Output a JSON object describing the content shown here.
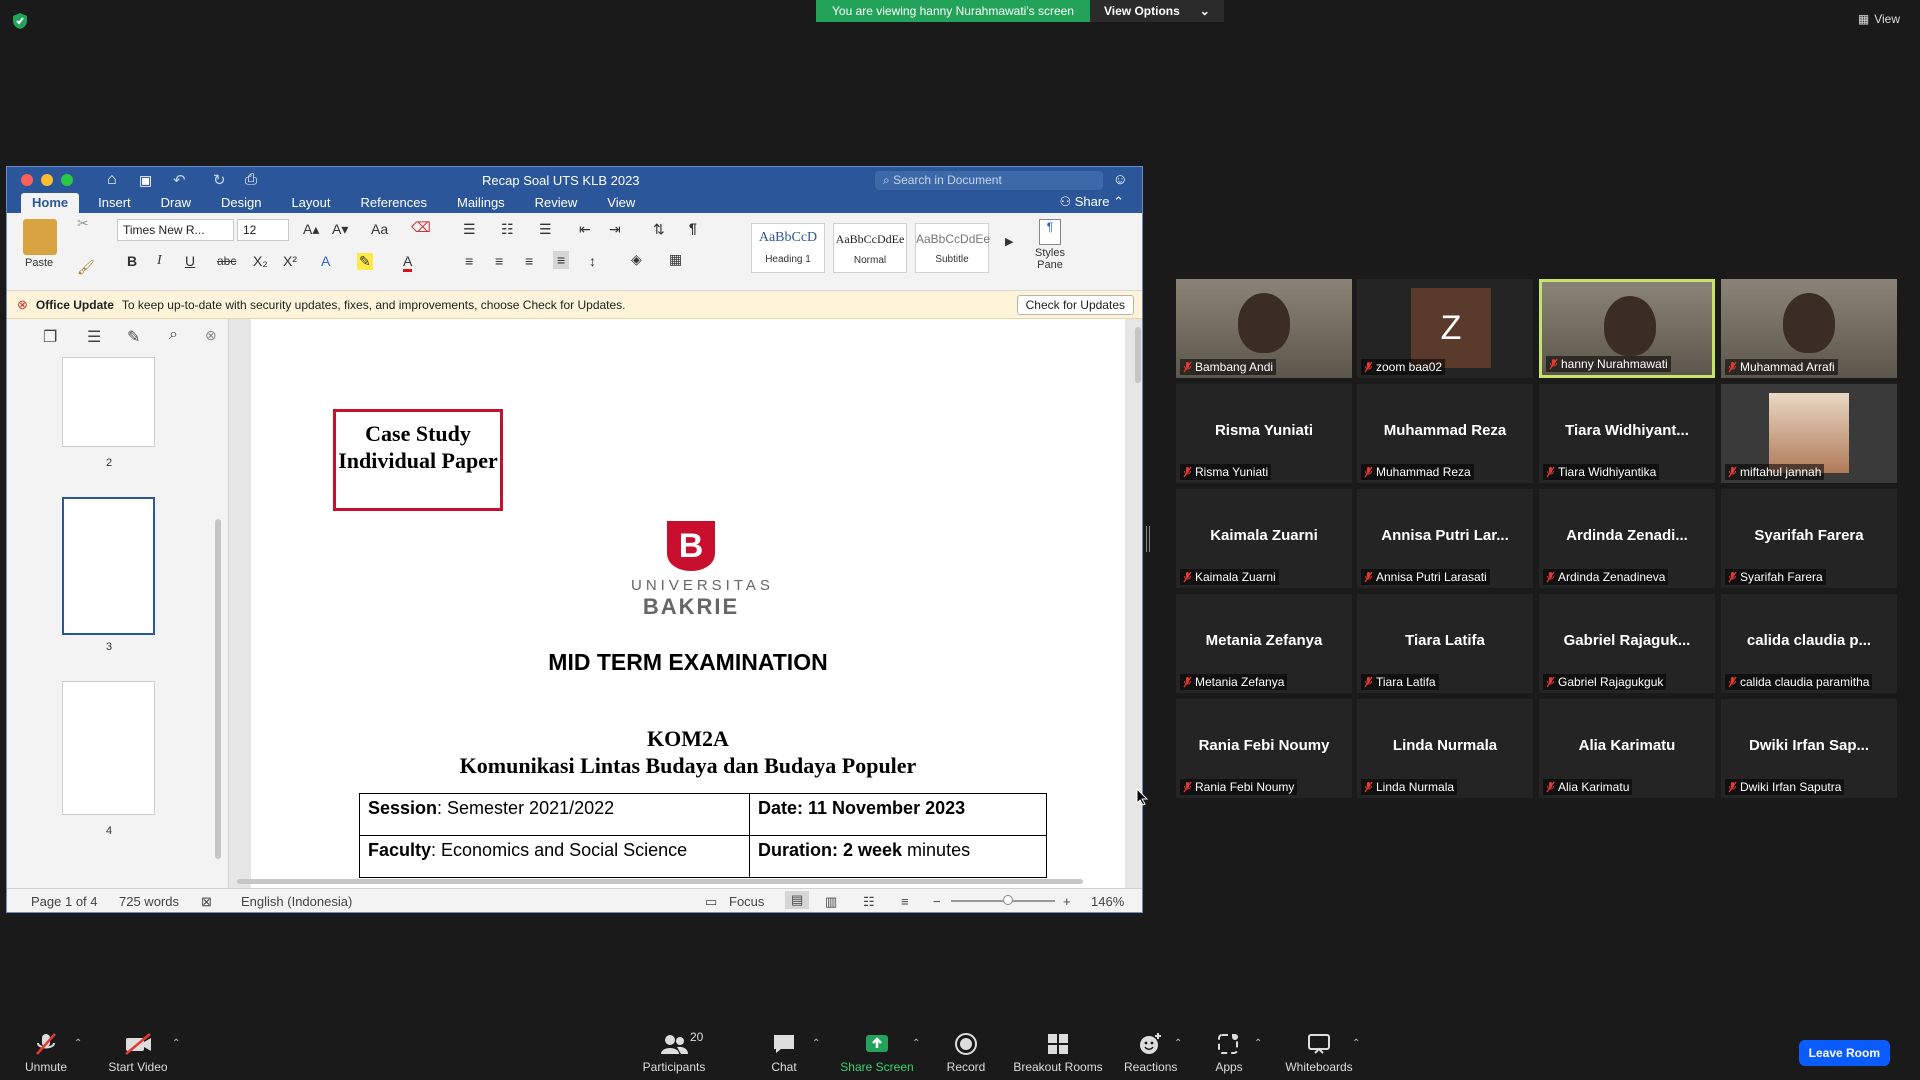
{
  "zoom_top": {
    "viewing_banner": "You are viewing hanny Nurahmawati's screen",
    "view_options_label": "View Options",
    "view_label": "View"
  },
  "word": {
    "title": "Recap Soal UTS KLB 2023",
    "search_placeholder": "Search in Document",
    "tabs": [
      "Home",
      "Insert",
      "Draw",
      "Design",
      "Layout",
      "References",
      "Mailings",
      "Review",
      "View"
    ],
    "share_label": "Share",
    "paste_label": "Paste",
    "font_name": "Times New R...",
    "font_size": "12",
    "styles": [
      {
        "preview": "AaBbCcD",
        "name": "Heading 1"
      },
      {
        "preview": "AaBbCcDdEe",
        "name": "Normal"
      },
      {
        "preview": "AaBbCcDdEe",
        "name": "Subtitle"
      }
    ],
    "styles_pane_label": "Styles Pane",
    "update_title": "Office Update",
    "update_message": "To keep up-to-date with security updates, fixes, and improvements, choose Check for Updates.",
    "update_button": "Check for Updates",
    "thumbnail_pages": [
      "2",
      "3",
      "4"
    ],
    "document": {
      "case_box": "Case Study Individual Paper",
      "logo_top": "UNIVERSITAS",
      "logo_bottom": "BAKRIE",
      "exam_title": "MID TERM EXAMINATION",
      "course_code": "KOM2A",
      "course_name": "Komunikasi Lintas Budaya dan Budaya Populer",
      "table": {
        "session_label": "Session",
        "session_value": ": Semester 2021/2022",
        "date_label": "Date: 11 November 2023",
        "faculty_label": "Faculty",
        "faculty_value": ": Economics and Social Science",
        "duration_label": "Duration: 2 week",
        "duration_value": " minutes"
      }
    },
    "status": {
      "page": "Page 1 of 4",
      "words": "725 words",
      "language": "English (Indonesia)",
      "focus": "Focus",
      "zoom": "146%"
    }
  },
  "participants": [
    {
      "center": "",
      "label": "Bambang Andi",
      "video": true
    },
    {
      "center": "",
      "label": "zoom baa02",
      "avatar": "Z"
    },
    {
      "center": "",
      "label": "hanny Nurahmawati",
      "video": true,
      "active": true
    },
    {
      "center": "",
      "label": "Muhammad Arrafi",
      "video": true
    },
    {
      "center": "Risma Yuniati",
      "label": "Risma Yuniati"
    },
    {
      "center": "Muhammad Reza",
      "label": "Muhammad Reza"
    },
    {
      "center": "Tiara  Widhiyant...",
      "label": "Tiara Widhiyantika"
    },
    {
      "center": "",
      "label": "miftahul jannah",
      "photo": true
    },
    {
      "center": "Kaimala Zuarni",
      "label": "Kaimala Zuarni"
    },
    {
      "center": "Annisa Putri Lar...",
      "label": "Annisa Putri Larasati"
    },
    {
      "center": "Ardinda  Zenadi...",
      "label": "Ardinda Zenadineva"
    },
    {
      "center": "Syarifah Farera",
      "label": "Syarifah Farera"
    },
    {
      "center": "Metania Zefanya",
      "label": "Metania Zefanya"
    },
    {
      "center": "Tiara Latifa",
      "label": "Tiara Latifa"
    },
    {
      "center": "Gabriel  Rajaguk...",
      "label": "Gabriel Rajagukguk"
    },
    {
      "center": "calida  claudia  p...",
      "label": "calida claudia paramitha"
    },
    {
      "center": "Rania Febi Noumy",
      "label": "Rania Febi Noumy"
    },
    {
      "center": "Linda Nurmala",
      "label": "Linda Nurmala"
    },
    {
      "center": "Alia Karimatu",
      "label": "Alia Karimatu"
    },
    {
      "center": "Dwiki  Irfan  Sap...",
      "label": "Dwiki Irfan Saputra"
    }
  ],
  "toolbar": {
    "unmute": "Unmute",
    "start_video": "Start Video",
    "participants": "Participants",
    "participants_count": "20",
    "chat": "Chat",
    "share_screen": "Share Screen",
    "record": "Record",
    "breakout": "Breakout Rooms",
    "reactions": "Reactions",
    "apps": "Apps",
    "whiteboards": "Whiteboards",
    "leave": "Leave Room"
  },
  "colors": {
    "zoom_green": "#23a35a",
    "word_blue": "#2b579a",
    "leave_blue": "#0b5cff",
    "active_speaker": "#c7e36b",
    "bakrie_red": "#c8102e"
  }
}
